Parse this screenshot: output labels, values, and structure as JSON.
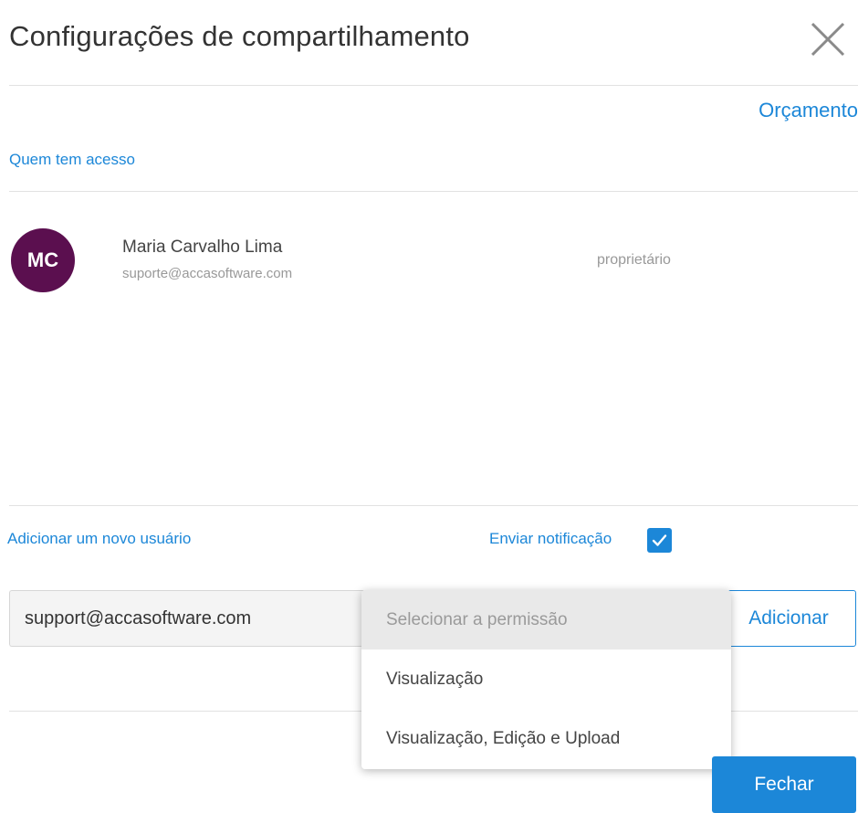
{
  "dialog": {
    "title": "Configurações de compartilhamento",
    "close_icon": "close-icon"
  },
  "project_link": "Orçamento",
  "access": {
    "label": "Quem tem acesso",
    "users": [
      {
        "initials": "MC",
        "name": "Maria Carvalho Lima",
        "email": "suporte@accasoftware.com",
        "role": "proprietário",
        "avatar_color": "#5b0f4f"
      }
    ]
  },
  "add_user": {
    "label": "Adicionar um novo usuário",
    "notify_label": "Enviar notificação",
    "notify_checked": true,
    "email_value": "support@accasoftware.com",
    "add_button_label": "Adicionar"
  },
  "permission_dropdown": {
    "placeholder": "Selecionar a permissão",
    "options": [
      "Visualização",
      "Visualização, Edição e Upload"
    ]
  },
  "footer": {
    "close_button_label": "Fechar"
  },
  "colors": {
    "accent": "#1c87d8",
    "avatar": "#5b0f4f",
    "divider": "#e2e2e2"
  }
}
